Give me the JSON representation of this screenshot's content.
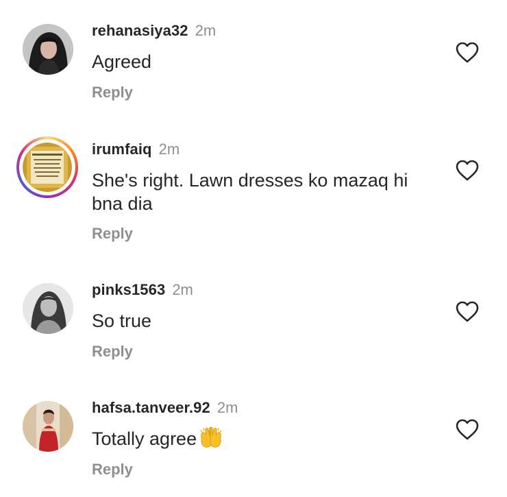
{
  "comments": [
    {
      "username": "rehanasiya32",
      "time": "2m",
      "text": "Agreed",
      "reply": "Reply",
      "avatar_icon": "user-photo-woman-dark-hair",
      "like_icon": "heart-outline-icon"
    },
    {
      "username": "irumfaiq",
      "time": "2m",
      "text": "She's right. Lawn dresses ko mazaq hi bna dia",
      "reply": "Reply",
      "avatar_icon": "framed-calligraphy-with-story-ring",
      "like_icon": "heart-outline-icon"
    },
    {
      "username": "pinks1563",
      "time": "2m",
      "text": "So true",
      "reply": "Reply",
      "avatar_icon": "user-photo-grayscale-woman",
      "like_icon": "heart-outline-icon"
    },
    {
      "username": "hafsa.tanveer.92",
      "time": "2m",
      "text": "Totally agree",
      "emoji": "raising-hands-emoji",
      "reply": "Reply",
      "avatar_icon": "user-photo-woman-red-outfit",
      "like_icon": "heart-outline-icon"
    }
  ],
  "colors": {
    "primary_text": "#262626",
    "secondary_text": "#8e8e8e",
    "background": "#ffffff",
    "story_ring": [
      "#feda75",
      "#fa7e1e",
      "#d62976",
      "#962fbf",
      "#4f5bd5"
    ]
  }
}
